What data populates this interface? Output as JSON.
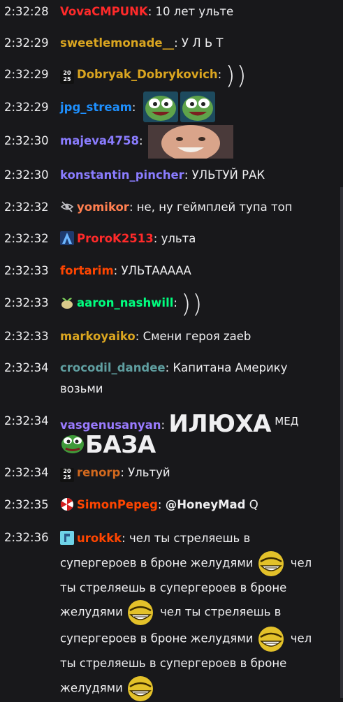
{
  "messages": [
    {
      "time": "2:32:28",
      "user": "VovaCMPUNK",
      "color": "#ff2a2a",
      "text": "10 лет ульте"
    },
    {
      "time": "2:32:29",
      "user": "sweetlemonade__",
      "color": "#daa520",
      "text": "У Л Ь Т"
    },
    {
      "time": "2:32:29",
      "user": "Dobryak_Dobrykovich",
      "color": "#daa520",
      "badge": "2025-badge",
      "text": "))"
    },
    {
      "time": "2:32:29",
      "user": "jpg_stream",
      "color": "#1e90ff",
      "emotes": [
        "pepe-laugh-emote",
        "pepe-laugh-emote"
      ]
    },
    {
      "time": "2:32:30",
      "user": "majeva4758",
      "color": "#8a7cff",
      "emotes": [
        "face-emote"
      ]
    },
    {
      "time": "2:32:30",
      "user": "konstantin_pincher",
      "color": "#8a7cff",
      "text": "УЛЬТУЙ РАК"
    },
    {
      "time": "2:32:32",
      "user": "yomikor",
      "color": "#ff7f50",
      "badge": "no-eye-badge",
      "text": "не, ну геймплей тупа топ"
    },
    {
      "time": "2:32:32",
      "user": "ProroK2513",
      "color": "#ff2a2a",
      "badge": "a-badge",
      "text": "ульта"
    },
    {
      "time": "2:32:33",
      "user": "fortarim",
      "color": "#ff4500",
      "text": "УЛЬТААААА"
    },
    {
      "time": "2:32:33",
      "user": "aaron_nashwill",
      "color": "#00ff7f",
      "badge": "sprout-badge",
      "text": "))"
    },
    {
      "time": "2:32:33",
      "user": "markoyaiko",
      "color": "#daa520",
      "text": "Смени героя zaeb"
    },
    {
      "time": "2:32:34",
      "user": "crocodil_dandee",
      "color": "#5f9ea0",
      "text": "Капитана Америку возьми"
    },
    {
      "time": "2:32:34",
      "user": "vasgenusanyan",
      "color": "#9a7bff",
      "big1": "ИЛЮХА",
      "small": "МЕД",
      "big2": "БАЗА"
    },
    {
      "time": "2:32:34",
      "user": "renorp",
      "color": "#d2691e",
      "badge": "2025-badge",
      "text": "Ультуй"
    },
    {
      "time": "2:32:35",
      "user": "SimonPepeg",
      "color": "#ff4500",
      "badge": "umbrella-badge",
      "mention": "@HoneyMad",
      "text": "Q"
    },
    {
      "time": "2:32:36",
      "user": "urokkk",
      "color": "#ff4500",
      "badge": "bits-badge",
      "segments": [
        "чел ты стреляешь в супергероев в броне желудями",
        "чел ты стреляешь в супергероев в броне желудями",
        "чел ты стреляешь в супергероев в броне желудями",
        "чел ты стреляешь в супергероев в броне желудями"
      ]
    }
  ],
  "badge_2025_text": [
    "20",
    "25"
  ],
  "colors": {
    "background": "#18181b",
    "text": "#efeff1",
    "scrollbar": "#2f2f35"
  }
}
